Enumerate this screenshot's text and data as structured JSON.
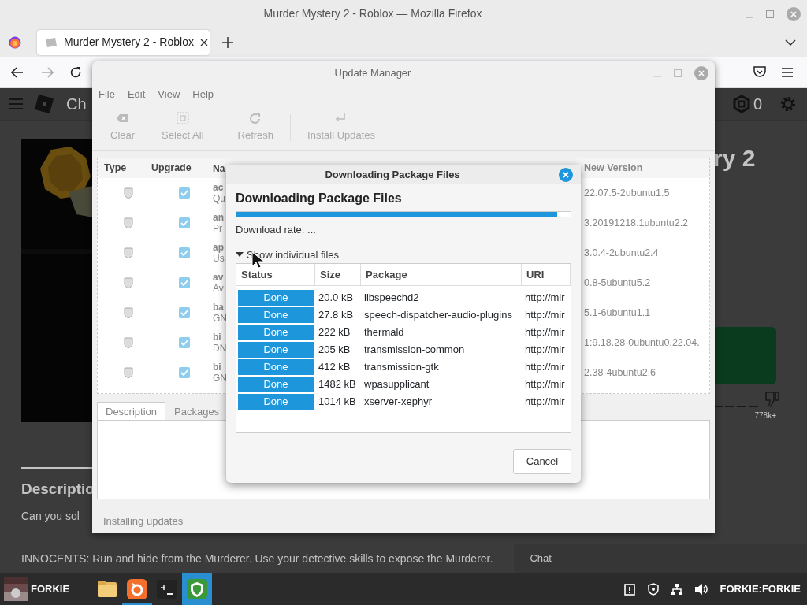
{
  "browser": {
    "title": "Murder Mystery 2 - Roblox — Mozilla Firefox",
    "tabs": [
      {
        "label": "Murder Mystery 2 - Roblox",
        "selected": true
      }
    ]
  },
  "page": {
    "header_text": "Ch",
    "robux": "0",
    "title_fragment": "ry 2",
    "rating_count": "778k+",
    "description_heading": "Descriptio",
    "description_fragment": "Can you sol",
    "description_text": "INNOCENTS: Run and hide from the Murderer. Use your detective skills to expose the Murderer.",
    "chat_label": "Chat"
  },
  "update_manager": {
    "title": "Update Manager",
    "menu": [
      "File",
      "Edit",
      "View",
      "Help"
    ],
    "toolbar": [
      {
        "kind": "clear",
        "label": "Clear",
        "disabled": true
      },
      {
        "kind": "select",
        "label": "Select All",
        "disabled": true
      },
      {
        "kind": "refresh",
        "label": "Refresh",
        "disabled": true
      },
      {
        "kind": "install",
        "label": "Install Updates",
        "disabled": true
      }
    ],
    "columns": [
      "Type",
      "Upgrade",
      "Na",
      "New Version"
    ],
    "rows": [
      {
        "checked": true,
        "name": "ac",
        "description": "Qu",
        "new_version": "22.07.5-2ubuntu1.5"
      },
      {
        "checked": true,
        "name": "an",
        "description": "Pr",
        "new_version": "3.20191218.1ubuntu2.2"
      },
      {
        "checked": true,
        "name": "ap",
        "description": "Us",
        "new_version": "3.0.4-2ubuntu2.4"
      },
      {
        "checked": true,
        "name": "av",
        "description": "Av",
        "new_version": "0.8-5ubuntu5.2"
      },
      {
        "checked": true,
        "name": "ba",
        "description": "GN",
        "new_version": "5.1-6ubuntu1.1"
      },
      {
        "checked": true,
        "name": "bi",
        "description": "DN",
        "new_version": "1:9.18.28-0ubuntu0.22.04."
      },
      {
        "checked": true,
        "name": "bi",
        "description": "GN",
        "new_version": "2.38-4ubuntu2.6"
      }
    ],
    "tabs": [
      {
        "label": "Description",
        "selected": true
      },
      {
        "label": "Packages",
        "selected": false
      }
    ],
    "status_bar": "Installing updates"
  },
  "dialog": {
    "title": "Downloading Package Files",
    "heading": "Downloading Package Files",
    "level": 0.96,
    "rate": "Download rate: ...",
    "expander": {
      "label": "Show individual files",
      "expanded": true
    },
    "columns": [
      "Status",
      "Size",
      "Package",
      "URI"
    ],
    "files": [
      {
        "status": "Done",
        "size": "20.0 kB",
        "package": "libspeechd2",
        "uri": "http://mir"
      },
      {
        "status": "Done",
        "size": "27.8 kB",
        "package": "speech-dispatcher-audio-plugins",
        "uri": "http://mir"
      },
      {
        "status": "Done",
        "size": "222 kB",
        "package": "thermald",
        "uri": "http://mir"
      },
      {
        "status": "Done",
        "size": "205 kB",
        "package": "transmission-common",
        "uri": "http://mir"
      },
      {
        "status": "Done",
        "size": "412 kB",
        "package": "transmission-gtk",
        "uri": "http://mir"
      },
      {
        "status": "Done",
        "size": "1482 kB",
        "package": "wpasupplicant",
        "uri": "http://mir"
      },
      {
        "status": "Done",
        "size": "1014 kB",
        "package": "xserver-xephyr",
        "uri": "http://mir"
      }
    ],
    "cancel": "Cancel"
  },
  "taskbar": {
    "user": "FORKIE",
    "apps": [
      {
        "kind": "folder",
        "running": false,
        "selected": false
      },
      {
        "kind": "browser",
        "running": true,
        "selected": false
      },
      {
        "kind": "terminal",
        "running": false,
        "selected": false
      },
      {
        "kind": "shield",
        "running": false,
        "selected": true
      }
    ],
    "session": "FORKIE:FORKIE"
  }
}
